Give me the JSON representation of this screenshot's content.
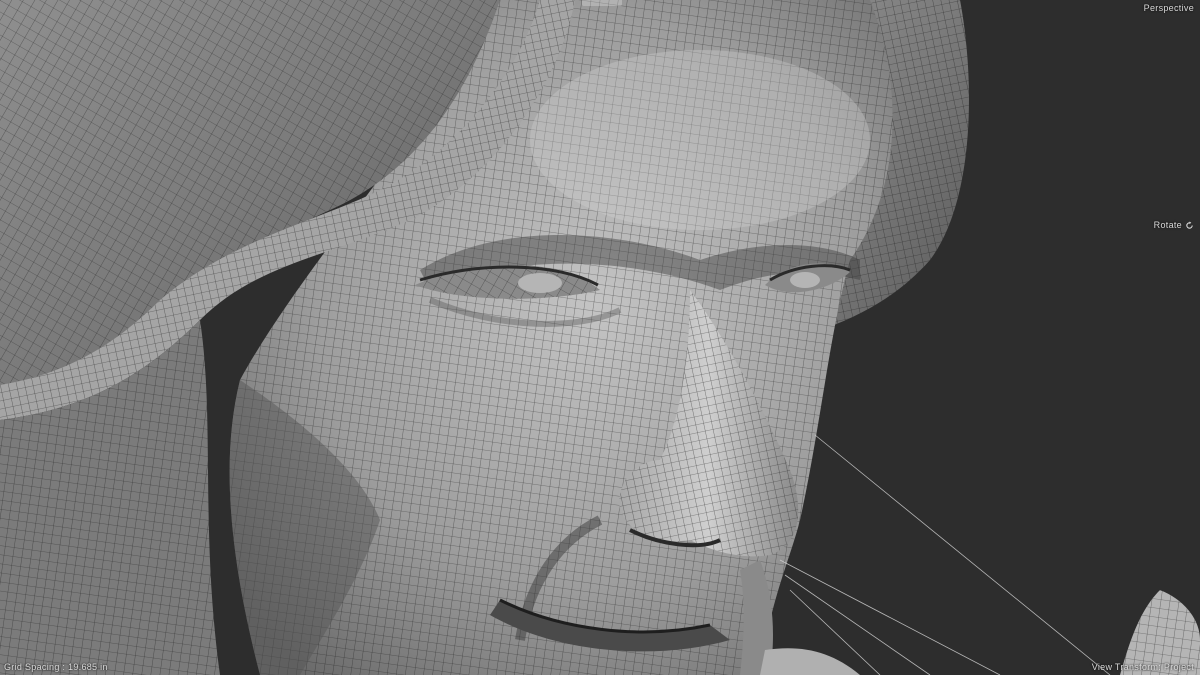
{
  "viewport": {
    "view_label": "Perspective",
    "navigation_mode": "Rotate",
    "navigation_icon": "rotate-icon",
    "grid_spacing_label": "Grid Spacing : 19.685 in",
    "transform_space": "View Transform: Project"
  },
  "colors": {
    "background": "#2d2d2d",
    "mesh_light": "#bdbdbd",
    "mesh_mid": "#8c8c8c",
    "mesh_dark": "#4a4a4a",
    "wire": "#1a1a1a",
    "guide_line": "#cfcfcf"
  }
}
